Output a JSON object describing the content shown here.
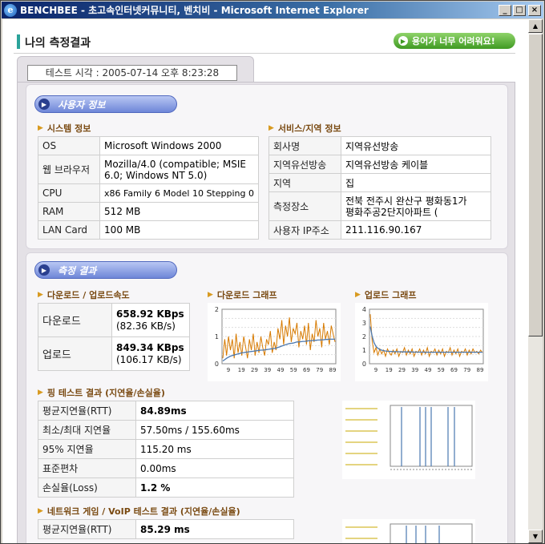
{
  "window": {
    "title": "BENCHBEE - 초고속인터넷커뮤니티, 벤치비 - Microsoft Internet Explorer",
    "minimize": "_",
    "maximize": "□",
    "close": "×"
  },
  "page": {
    "title": "나의 측정결과",
    "help_button": "용어가 너무 어려워요!",
    "test_time": "테스트 시각 : 2005-07-14 오후 8:23:28"
  },
  "user_info": {
    "header": "사용자 정보",
    "system": {
      "title": "시스템 정보",
      "rows": [
        {
          "k": "OS",
          "v": "Microsoft Windows 2000"
        },
        {
          "k": "웹 브라우저",
          "v1": "Mozilla/4.0 (compatible; MSIE",
          "v2": "6.0; Windows NT 5.0)"
        },
        {
          "k": "CPU",
          "v": "x86 Family 6 Model 10 Stepping 0"
        },
        {
          "k": "RAM",
          "v": "512 MB"
        },
        {
          "k": "LAN Card",
          "v": "100 MB"
        }
      ]
    },
    "service": {
      "title": "서비스/지역 정보",
      "rows": [
        {
          "k": "회사명",
          "v": "지역유선방송"
        },
        {
          "k": "지역유선방송",
          "v": "지역유선방송 케이블"
        },
        {
          "k": "지역",
          "v": "집"
        },
        {
          "k": "측정장소",
          "v1": "전북 전주시 완산구 평화동1가",
          "v2": "평화주공2단지아파트 ("
        },
        {
          "k": "사용자 IP주소",
          "v": "211.116.90.167"
        }
      ]
    }
  },
  "results": {
    "header": "측정 결과",
    "speed": {
      "title": "다운로드 / 업로드속도",
      "download_label": "다운로드",
      "download_main": "658.92 KBps",
      "download_sub": "(82.36 KB/s)",
      "upload_label": "업로드",
      "upload_main": "849.34 KBps",
      "upload_sub": "(106.17 KB/s)"
    },
    "download_graph_title": "다운로드 그래프",
    "upload_graph_title": "업로드 그래프",
    "ping": {
      "title": "핑 테스트 결과 (지연율/손실율)",
      "rows": [
        {
          "k": "평균지연율(RTT)",
          "v": "84.89ms"
        },
        {
          "k": "최소/최대 지연율",
          "v": "57.50ms / 155.60ms"
        },
        {
          "k": "95% 지연율",
          "v": "115.20 ms"
        },
        {
          "k": "표준편차",
          "v": "0.00ms"
        },
        {
          "k": "손실율(Loss)",
          "v": "1.2 %"
        }
      ]
    },
    "game": {
      "title": "네트워크 게임 / VoIP 테스트 결과 (지연율/손실율)",
      "rows": [
        {
          "k": "평균지연율(RTT)",
          "v": "85.29 ms"
        }
      ]
    }
  },
  "chart_data": [
    {
      "type": "line",
      "name": "download-graph",
      "x_ticks": [
        "9",
        "19",
        "29",
        "39",
        "49",
        "59",
        "69",
        "79",
        "89"
      ],
      "y_ticks": [
        "2",
        "1",
        "0"
      ],
      "ylim": [
        0,
        2
      ],
      "series": [
        {
          "color": "#d77a00",
          "values": [
            0.2,
            0.9,
            0.3,
            1.0,
            0.5,
            0.9,
            0.2,
            1.1,
            0.4,
            0.8,
            0.3,
            1.0,
            0.6,
            0.2,
            0.9,
            0.5,
            1.1,
            0.3,
            0.8,
            0.4,
            1.0,
            0.6,
            0.3,
            0.9,
            0.7,
            1.2,
            0.4,
            0.8,
            0.5,
            1.3,
            0.9,
            1.6,
            0.7,
            1.4,
            1.0,
            1.7,
            0.8,
            1.3,
            1.1,
            1.5,
            0.6,
            1.2,
            0.9,
            1.4,
            0.7,
            1.5,
            0.5,
            1.1,
            0.8,
            1.6,
            1.0,
            1.3,
            0.6,
            1.5,
            0.9,
            1.2,
            0.7,
            1.4,
            1.1,
            0.8
          ]
        },
        {
          "color": "#4a78b0",
          "values": [
            0.1,
            0.15,
            0.2,
            0.24,
            0.28,
            0.3,
            0.32,
            0.34,
            0.36,
            0.38,
            0.4,
            0.41,
            0.42,
            0.43,
            0.44,
            0.45,
            0.46,
            0.47,
            0.48,
            0.49,
            0.5,
            0.5,
            0.51,
            0.52,
            0.53,
            0.54,
            0.55,
            0.56,
            0.57,
            0.6,
            0.62,
            0.65,
            0.67,
            0.7,
            0.72,
            0.74,
            0.75,
            0.76,
            0.78,
            0.8,
            0.8,
            0.81,
            0.82,
            0.82,
            0.83,
            0.84,
            0.84,
            0.85,
            0.86,
            0.86,
            0.87,
            0.87,
            0.88,
            0.88,
            0.89,
            0.89,
            0.9,
            0.9,
            0.9,
            0.9
          ]
        }
      ]
    },
    {
      "type": "line",
      "name": "upload-graph",
      "x_ticks": [
        "9",
        "19",
        "29",
        "39",
        "49",
        "59",
        "69",
        "79",
        "89"
      ],
      "y_ticks": [
        "4",
        "3",
        "2",
        "1",
        "0"
      ],
      "ylim": [
        0,
        4.4
      ],
      "series": [
        {
          "color": "#d77a00",
          "values": [
            4.0,
            1.8,
            0.9,
            1.3,
            0.7,
            1.2,
            0.8,
            1.1,
            0.6,
            1.2,
            0.9,
            0.7,
            1.1,
            0.8,
            1.2,
            0.6,
            1.0,
            0.9,
            1.3,
            0.7,
            1.1,
            0.8,
            1.2,
            0.6,
            1.0,
            0.9,
            1.2,
            0.7,
            1.1,
            0.8,
            1.3,
            0.6,
            1.0,
            0.9,
            1.2,
            0.7,
            1.1,
            0.8,
            1.2,
            0.6,
            1.0,
            0.9,
            1.3,
            0.7,
            1.1,
            0.8,
            1.2,
            0.6,
            1.0,
            0.9,
            1.2,
            0.7,
            1.1,
            0.8,
            1.2,
            0.9,
            1.0,
            0.8,
            1.1,
            0.9
          ]
        },
        {
          "color": "#4a78b0",
          "values": [
            3.0,
            2.2,
            1.7,
            1.4,
            1.25,
            1.15,
            1.1,
            1.06,
            1.03,
            1.01,
            1.0,
            0.99,
            0.98,
            0.98,
            0.97,
            0.97,
            0.96,
            0.96,
            0.96,
            0.95,
            0.95,
            0.95,
            0.95,
            0.94,
            0.94,
            0.94,
            0.94,
            0.94,
            0.94,
            0.93,
            0.93,
            0.93,
            0.93,
            0.93,
            0.93,
            0.93,
            0.93,
            0.93,
            0.93,
            0.93,
            0.93,
            0.93,
            0.93,
            0.93,
            0.93,
            0.93,
            0.93,
            0.93,
            0.93,
            0.93,
            0.93,
            0.93,
            0.93,
            0.93,
            0.93,
            0.93,
            0.93,
            0.93,
            0.93,
            0.93
          ]
        }
      ]
    }
  ],
  "colors": {
    "accent_teal": "#2ba39a",
    "pill_blue": "#6e86d8",
    "help_green": "#3f9a22",
    "section_title": "#7a4a12"
  }
}
